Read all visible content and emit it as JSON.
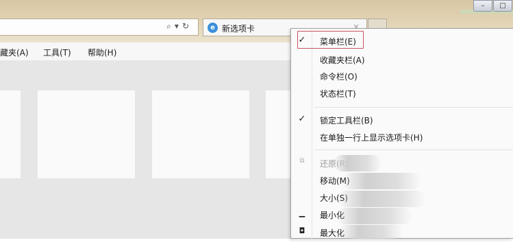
{
  "window": {
    "minimize_label": "–",
    "maximize_label": "□"
  },
  "address_bar": {
    "search_icon": "search-icon",
    "dropdown_icon": "▾",
    "refresh_icon": "refresh-icon"
  },
  "tab": {
    "title": "新选项卡",
    "icon": "ie-icon",
    "close": "×"
  },
  "menubar": {
    "items": [
      "藏夹(A)",
      "工具(T)",
      "帮助(H)"
    ]
  },
  "context_menu": {
    "items": [
      {
        "label": "菜单栏(E)",
        "checked": true,
        "highlighted": true
      },
      {
        "label": "收藏夹栏(A)",
        "checked": false
      },
      {
        "label": "命令栏(O)",
        "checked": false
      },
      {
        "label": "状态栏(T)",
        "checked": false
      },
      {
        "label": "锁定工具栏(B)",
        "checked": true
      },
      {
        "label": "在单独一行上显示选项卡(H)",
        "checked": false
      },
      {
        "label": "还原(R)",
        "disabled": true,
        "icon": "restore-icon"
      },
      {
        "label": "移动(M)"
      },
      {
        "label": "大小(S)"
      },
      {
        "label": "最小化",
        "icon": "minimize-icon"
      },
      {
        "label": "最大化",
        "icon": "maximize-icon"
      }
    ],
    "check_mark": "✓",
    "restore_glyph": "⧉",
    "minimize_glyph": "▁",
    "maximize_glyph": "◘"
  },
  "colors": {
    "titlebar": "#dccbaa",
    "content_bg": "#e6e6e6",
    "tile_bg": "#fafafa",
    "highlight_border": "#c9545f"
  }
}
